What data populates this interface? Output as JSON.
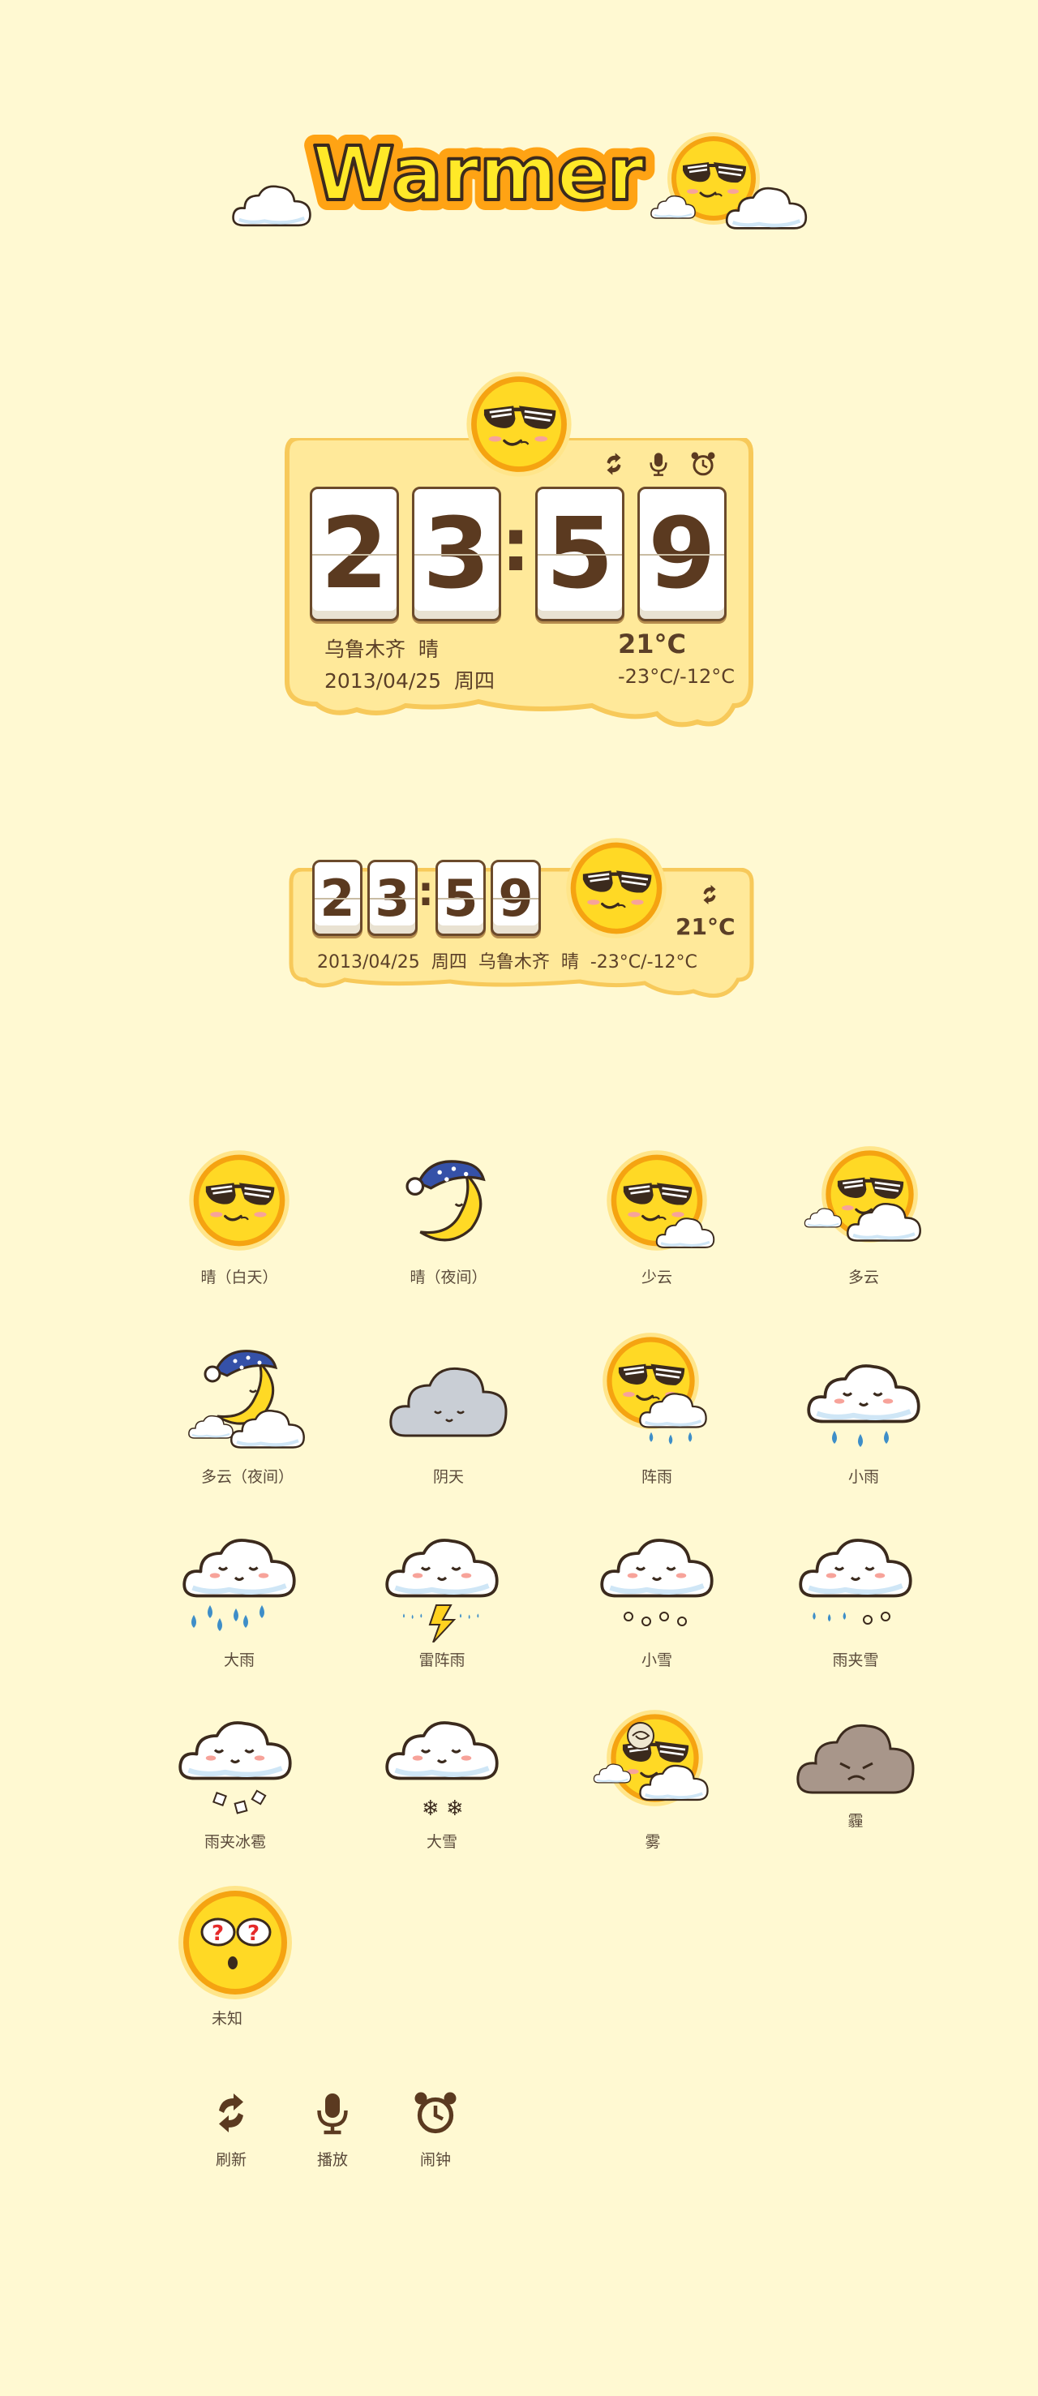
{
  "logo": {
    "text": "Warmer"
  },
  "widget_large": {
    "digits": [
      "2",
      "3",
      "5",
      "9"
    ],
    "city": "乌鲁木齐",
    "weather": "晴",
    "date": "2013/04/25",
    "weekday": "周四",
    "temp": "21°C",
    "range": "-23°C/-12°C",
    "icons": [
      "refresh-icon",
      "microphone-icon",
      "alarm-clock-icon"
    ]
  },
  "widget_small": {
    "digits": [
      "2",
      "3",
      "5",
      "9"
    ],
    "date": "2013/04/25",
    "weekday": "周四",
    "city": "乌鲁木齐",
    "weather": "晴",
    "temp": "21°C",
    "range": "-23°C/-12°C"
  },
  "weather_icons": [
    {
      "label": "晴（白天）",
      "icon": "sun-sunglasses-icon"
    },
    {
      "label": "晴（夜间）",
      "icon": "moon-nightcap-icon"
    },
    {
      "label": "少云",
      "icon": "sun-small-cloud-icon"
    },
    {
      "label": "多云",
      "icon": "sun-clouds-icon"
    },
    {
      "label": "多云（夜间）",
      "icon": "moon-clouds-icon"
    },
    {
      "label": "阴天",
      "icon": "grey-cloud-icon"
    },
    {
      "label": "阵雨",
      "icon": "sun-rain-icon"
    },
    {
      "label": "小雨",
      "icon": "light-rain-icon"
    },
    {
      "label": "大雨",
      "icon": "heavy-rain-icon"
    },
    {
      "label": "雷阵雨",
      "icon": "thunderstorm-icon"
    },
    {
      "label": "小雪",
      "icon": "light-snow-icon"
    },
    {
      "label": "雨夹雪",
      "icon": "sleet-icon"
    },
    {
      "label": "雨夹冰雹",
      "icon": "hail-icon"
    },
    {
      "label": "大雪",
      "icon": "heavy-snow-icon"
    },
    {
      "label": "雾",
      "icon": "fog-icon"
    },
    {
      "label": "霾",
      "icon": "haze-icon"
    },
    {
      "label": "未知",
      "icon": "unknown-icon"
    }
  ],
  "tools": [
    {
      "label": "刷新",
      "icon": "refresh-icon"
    },
    {
      "label": "播放",
      "icon": "microphone-icon"
    },
    {
      "label": "闹钟",
      "icon": "alarm-clock-icon"
    }
  ],
  "colors": {
    "background": "#fff9d2",
    "card": "#ffe99a",
    "card_border": "#f7c95a",
    "sun": "#ffd21f",
    "sun_ring": "#f39a12",
    "text": "#5b3f27"
  }
}
